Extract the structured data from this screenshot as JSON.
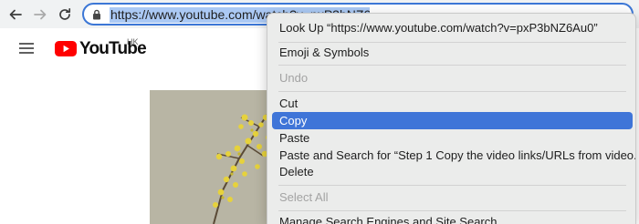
{
  "toolbar": {
    "back_icon": "arrow-left-icon",
    "forward_icon": "arrow-right-icon",
    "reload_icon": "reload-icon",
    "lock_icon": "lock-icon",
    "url": "https://www.youtube.com/watch?v=pxP3bNZ6Au0"
  },
  "page": {
    "menu_icon": "hamburger-icon",
    "logo_icon": "youtube-logo-icon",
    "logo_text": "YouTube",
    "region": "HK"
  },
  "context_menu": {
    "items": [
      {
        "label": "Look Up “https://www.youtube.com/watch?v=pxP3bNZ6Au0”",
        "disabled": false
      },
      {
        "label": "Emoji & Symbols",
        "disabled": false
      },
      {
        "label": "Undo",
        "disabled": true
      },
      {
        "label": "Cut",
        "disabled": false
      },
      {
        "label": "Copy",
        "disabled": false,
        "highlighted": true
      },
      {
        "label": "Paste",
        "disabled": false
      },
      {
        "label": "Paste and Search for “Step 1 Copy the video links/URLs from video...”",
        "disabled": false
      },
      {
        "label": "Delete",
        "disabled": false
      },
      {
        "label": "Select All",
        "disabled": true
      },
      {
        "label": "Manage Search Engines and Site Search",
        "disabled": false
      }
    ]
  },
  "colors": {
    "highlight": "#3f75d8",
    "url_selection": "#abc9f4",
    "youtube_red": "#ff0000"
  }
}
